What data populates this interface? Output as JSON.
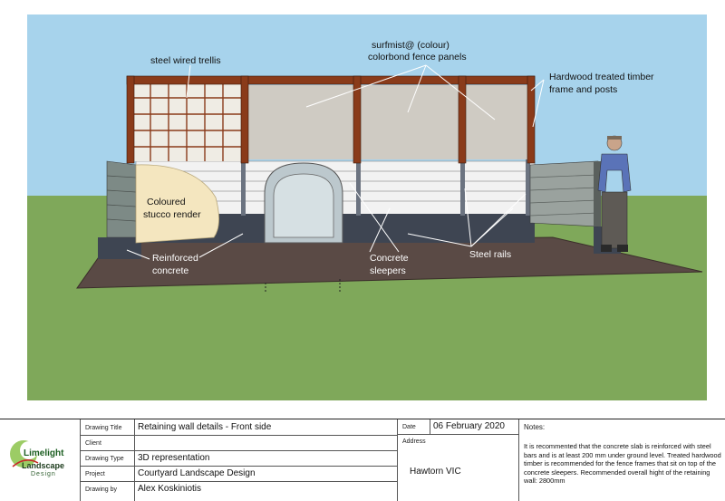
{
  "drawing": {
    "labels": {
      "trellis": "steel wired trellis",
      "panels_line1": "surfmist@ (colour)",
      "panels_line2": "colorbond fence panels",
      "timber_line1": "Hardwood treated timber",
      "timber_line2": "frame and posts",
      "stucco_line1": "Coloured",
      "stucco_line2": "stucco render",
      "concrete_line1": "Reinforced",
      "concrete_line2": "concrete",
      "sleepers_line1": "Concrete",
      "sleepers_line2": "sleepers",
      "rails": "Steel rails"
    },
    "colors": {
      "sky": "#a7d3ec",
      "grass": "#7fa85a",
      "slab": "#5a4a45",
      "timber": "#8a3b1a",
      "panel": "#cfcbc3",
      "sleeper": "#f2f2f2",
      "stucco": "#f4e6bf"
    }
  },
  "titleblock": {
    "logo": {
      "word1": "Limelight",
      "word2": "Landscape",
      "word3": "Design"
    },
    "drawing_title_label": "Drawing Title",
    "drawing_title": "Retaining wall details - Front side",
    "client_label": "Client",
    "client": "",
    "drawing_type_label": "Drawing Type",
    "drawing_type": "3D representation",
    "project_label": "Project",
    "project": "Courtyard Landscape Design",
    "drawing_by_label": "Drawing by",
    "drawing_by": "Alex Koskiniotis",
    "date_label": "Date",
    "date": "06 February 2020",
    "address_label": "Address",
    "address": "Hawtorn VIC",
    "notes_label": "Notes:",
    "notes": "It is recommented that the concrete slab is reinforced with steel bars and is at least 200 mm under ground level. Treated hardwood timber is recommended for the fence frames that sit on top of the concrete sleepers. Recommended overall hight of the retaining wall: 2800mm"
  }
}
